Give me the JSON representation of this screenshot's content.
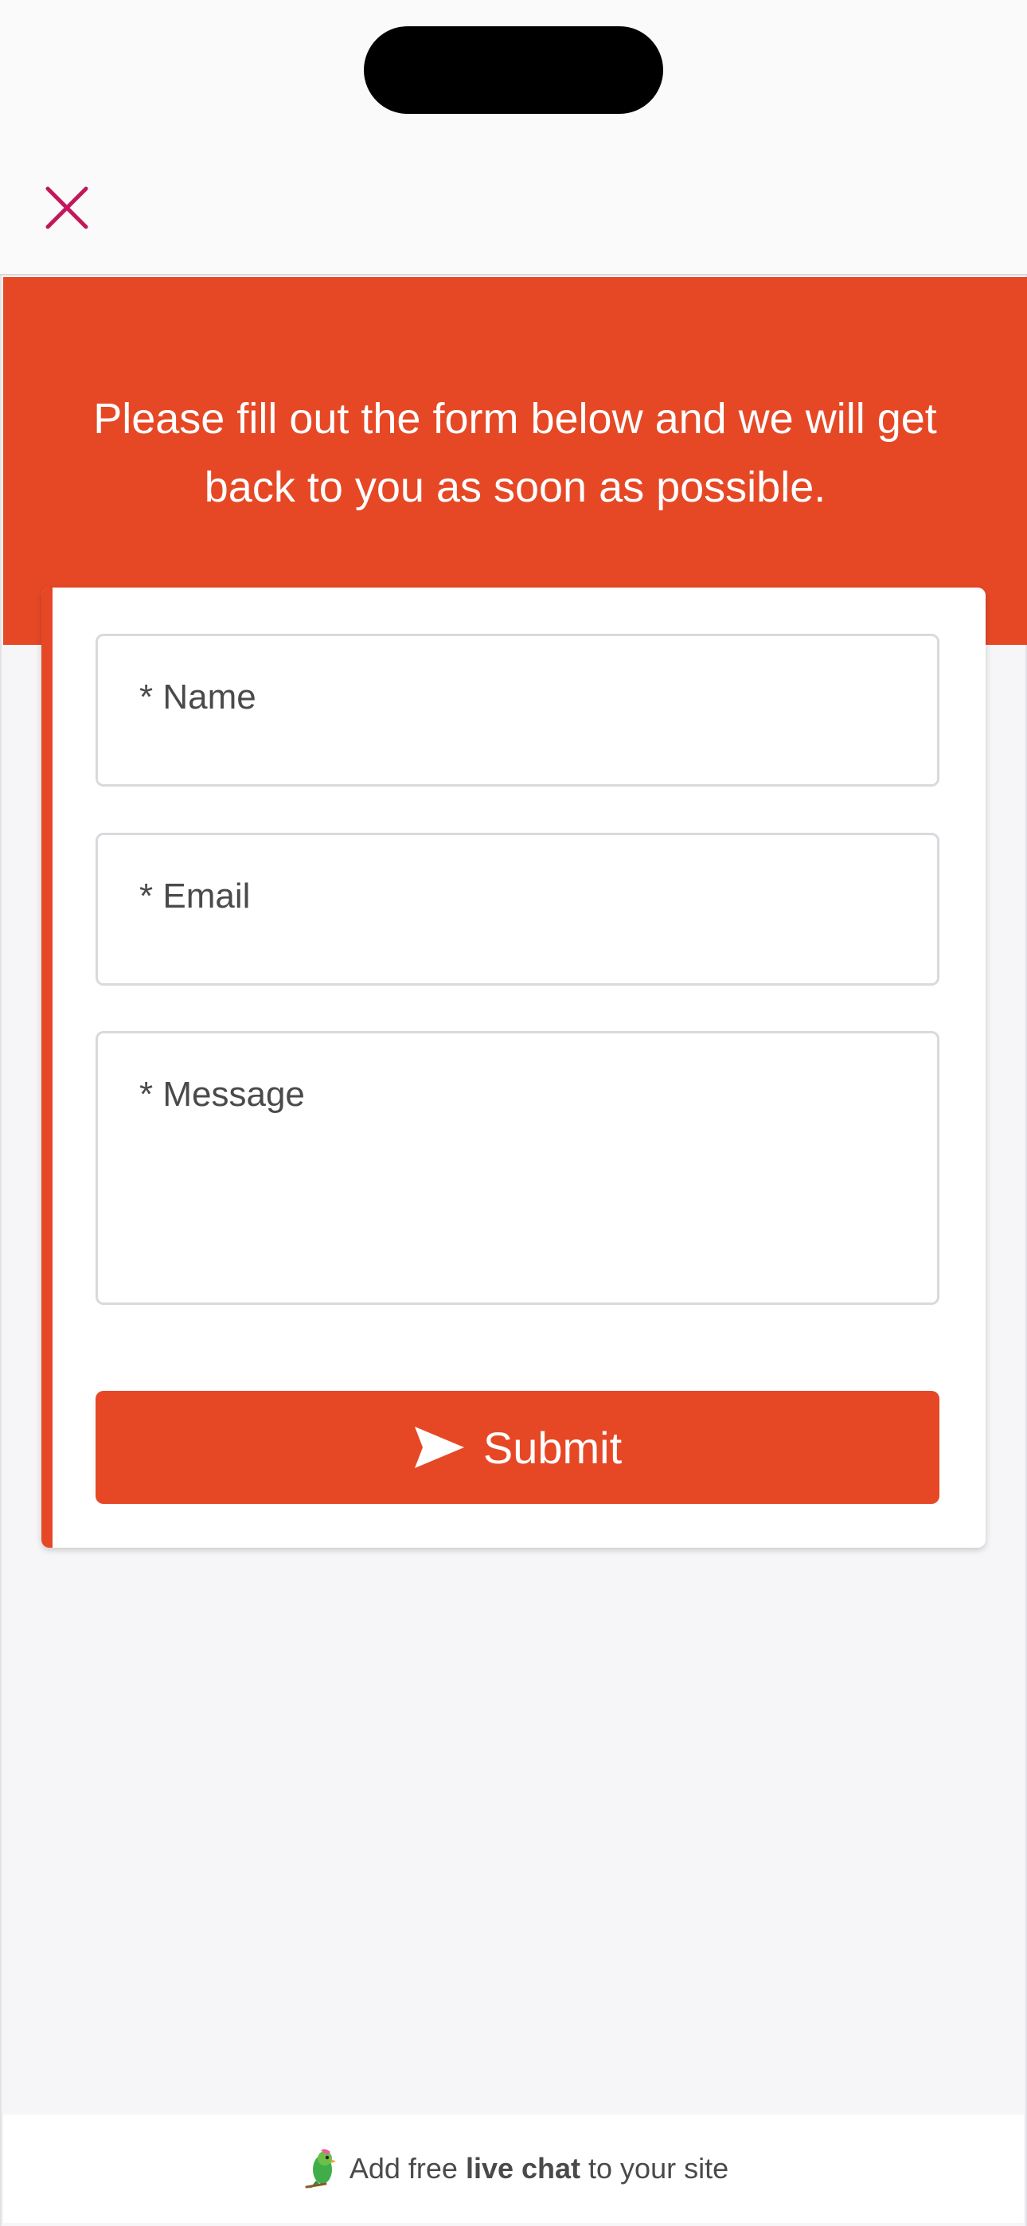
{
  "header": {
    "close_icon": "close-icon",
    "close_color": "#c2185b"
  },
  "banner": {
    "text": "Please fill out the form below and we will get back to you as soon as possible.",
    "color": "#e64826"
  },
  "form": {
    "name_placeholder": "* Name",
    "email_placeholder": "* Email",
    "message_placeholder": "* Message",
    "submit_label": "Submit",
    "submit_icon": "send-icon"
  },
  "footer": {
    "text_before": "Add free ",
    "text_bold": "live chat",
    "text_after": " to your site",
    "logo_icon": "parrot-logo-icon"
  }
}
